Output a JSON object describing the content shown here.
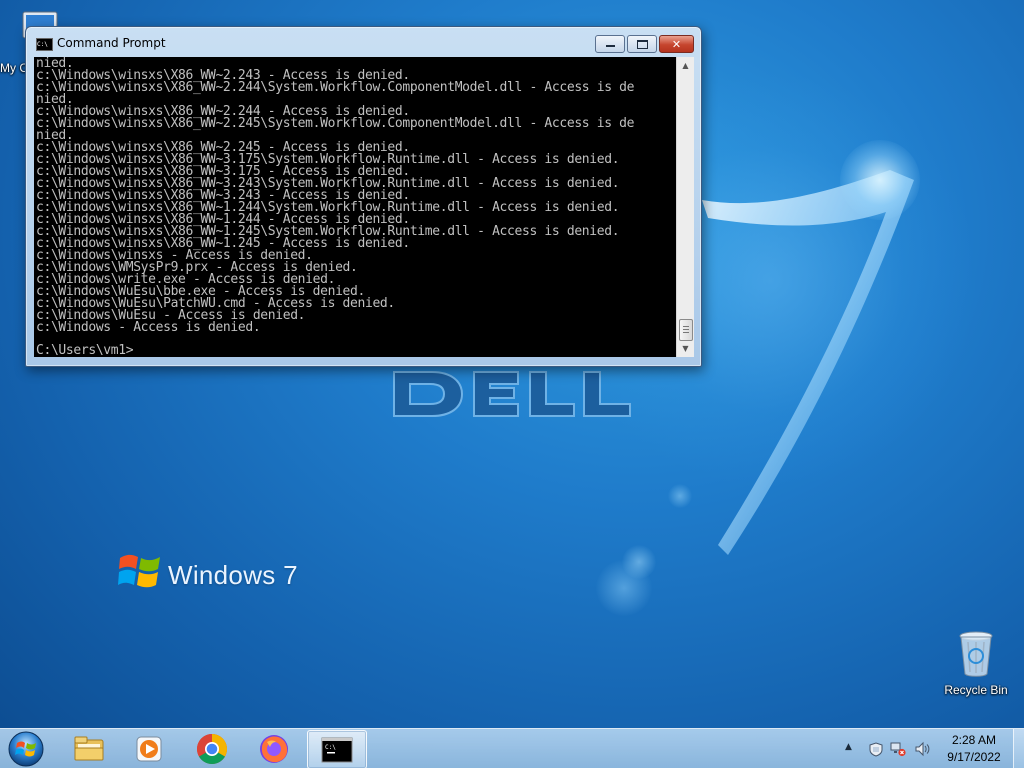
{
  "desktop": {
    "icons": [
      {
        "label": "My Computer",
        "icon": "computer-icon"
      },
      {
        "label": "Recycle Bin",
        "icon": "recycle-bin-icon"
      }
    ],
    "wallpaper": {
      "brand_text": "Windows",
      "brand_version": "7",
      "oem_logo": "dell-logo"
    }
  },
  "cmd_window": {
    "title": "Command Prompt",
    "title_icon_text": "C:\\",
    "console_lines": [
      "nied.",
      "c:\\Windows\\winsxs\\X86_WW~2.243 - Access is denied.",
      "c:\\Windows\\winsxs\\X86_WW~2.244\\System.Workflow.ComponentModel.dll - Access is de",
      "nied.",
      "c:\\Windows\\winsxs\\X86_WW~2.244 - Access is denied.",
      "c:\\Windows\\winsxs\\X86_WW~2.245\\System.Workflow.ComponentModel.dll - Access is de",
      "nied.",
      "c:\\Windows\\winsxs\\X86_WW~2.245 - Access is denied.",
      "c:\\Windows\\winsxs\\X86_WW~3.175\\System.Workflow.Runtime.dll - Access is denied.",
      "c:\\Windows\\winsxs\\X86_WW~3.175 - Access is denied.",
      "c:\\Windows\\winsxs\\X86_WW~3.243\\System.Workflow.Runtime.dll - Access is denied.",
      "c:\\Windows\\winsxs\\X86_WW~3.243 - Access is denied.",
      "c:\\Windows\\winsxs\\X86_WW~1.244\\System.Workflow.Runtime.dll - Access is denied.",
      "c:\\Windows\\winsxs\\X86_WW~1.244 - Access is denied.",
      "c:\\Windows\\winsxs\\X86_WW~1.245\\System.Workflow.Runtime.dll - Access is denied.",
      "c:\\Windows\\winsxs\\X86_WW~1.245 - Access is denied.",
      "c:\\Windows\\winsxs - Access is denied.",
      "c:\\Windows\\WMSysPr9.prx - Access is denied.",
      "c:\\Windows\\write.exe - Access is denied.",
      "c:\\Windows\\WuEsu\\bbe.exe - Access is denied.",
      "c:\\Windows\\WuEsu\\PatchWU.cmd - Access is denied.",
      "c:\\Windows\\WuEsu - Access is denied.",
      "c:\\Windows - Access is denied."
    ],
    "prompt": "C:\\Users\\vm1>"
  },
  "taskbar": {
    "start": "start-orb-icon",
    "pinned": [
      {
        "name": "Windows Explorer",
        "icon": "folder-icon"
      },
      {
        "name": "Windows Media Player",
        "icon": "media-player-icon"
      },
      {
        "name": "Google Chrome",
        "icon": "chrome-icon"
      },
      {
        "name": "Firefox",
        "icon": "firefox-icon"
      },
      {
        "name": "Command Prompt",
        "icon": "cmd-icon",
        "active": true
      }
    ],
    "tray": {
      "show_hidden": "▲",
      "icons": [
        "action-center-icon",
        "network-icon",
        "volume-icon"
      ],
      "time": "2:28 AM",
      "date": "9/17/2022"
    }
  },
  "colors": {
    "desktop_blue": "#1f7ccb",
    "console_bg": "#000000",
    "console_text": "#c0c0c0",
    "close_red": "#c6452e"
  }
}
